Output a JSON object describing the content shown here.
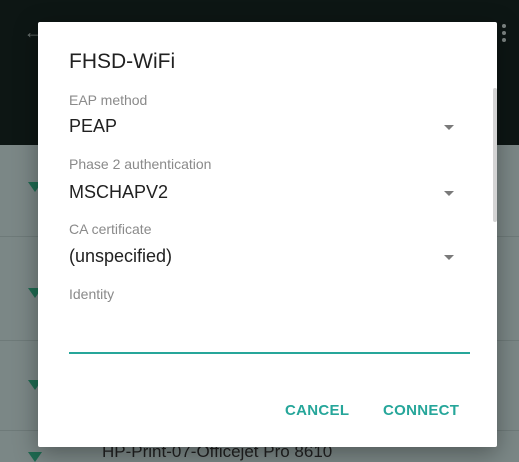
{
  "background": {
    "last_network": "HP-Print-07-Officejet Pro 8610"
  },
  "dialog": {
    "title": "FHSD-WiFi",
    "eap_method": {
      "label": "EAP method",
      "value": "PEAP"
    },
    "phase2": {
      "label": "Phase 2 authentication",
      "value": "MSCHAPV2"
    },
    "ca_certificate": {
      "label": "CA certificate",
      "value": "(unspecified)"
    },
    "identity": {
      "label": "Identity",
      "value": ""
    },
    "buttons": {
      "cancel": "CANCEL",
      "connect": "CONNECT"
    }
  },
  "colors": {
    "accent": "#26a69a",
    "scrim": "#7b8786"
  },
  "icons": [
    "back-arrow-icon",
    "more-vert-icon",
    "wifi-icon",
    "dropdown-arrow-icon"
  ]
}
